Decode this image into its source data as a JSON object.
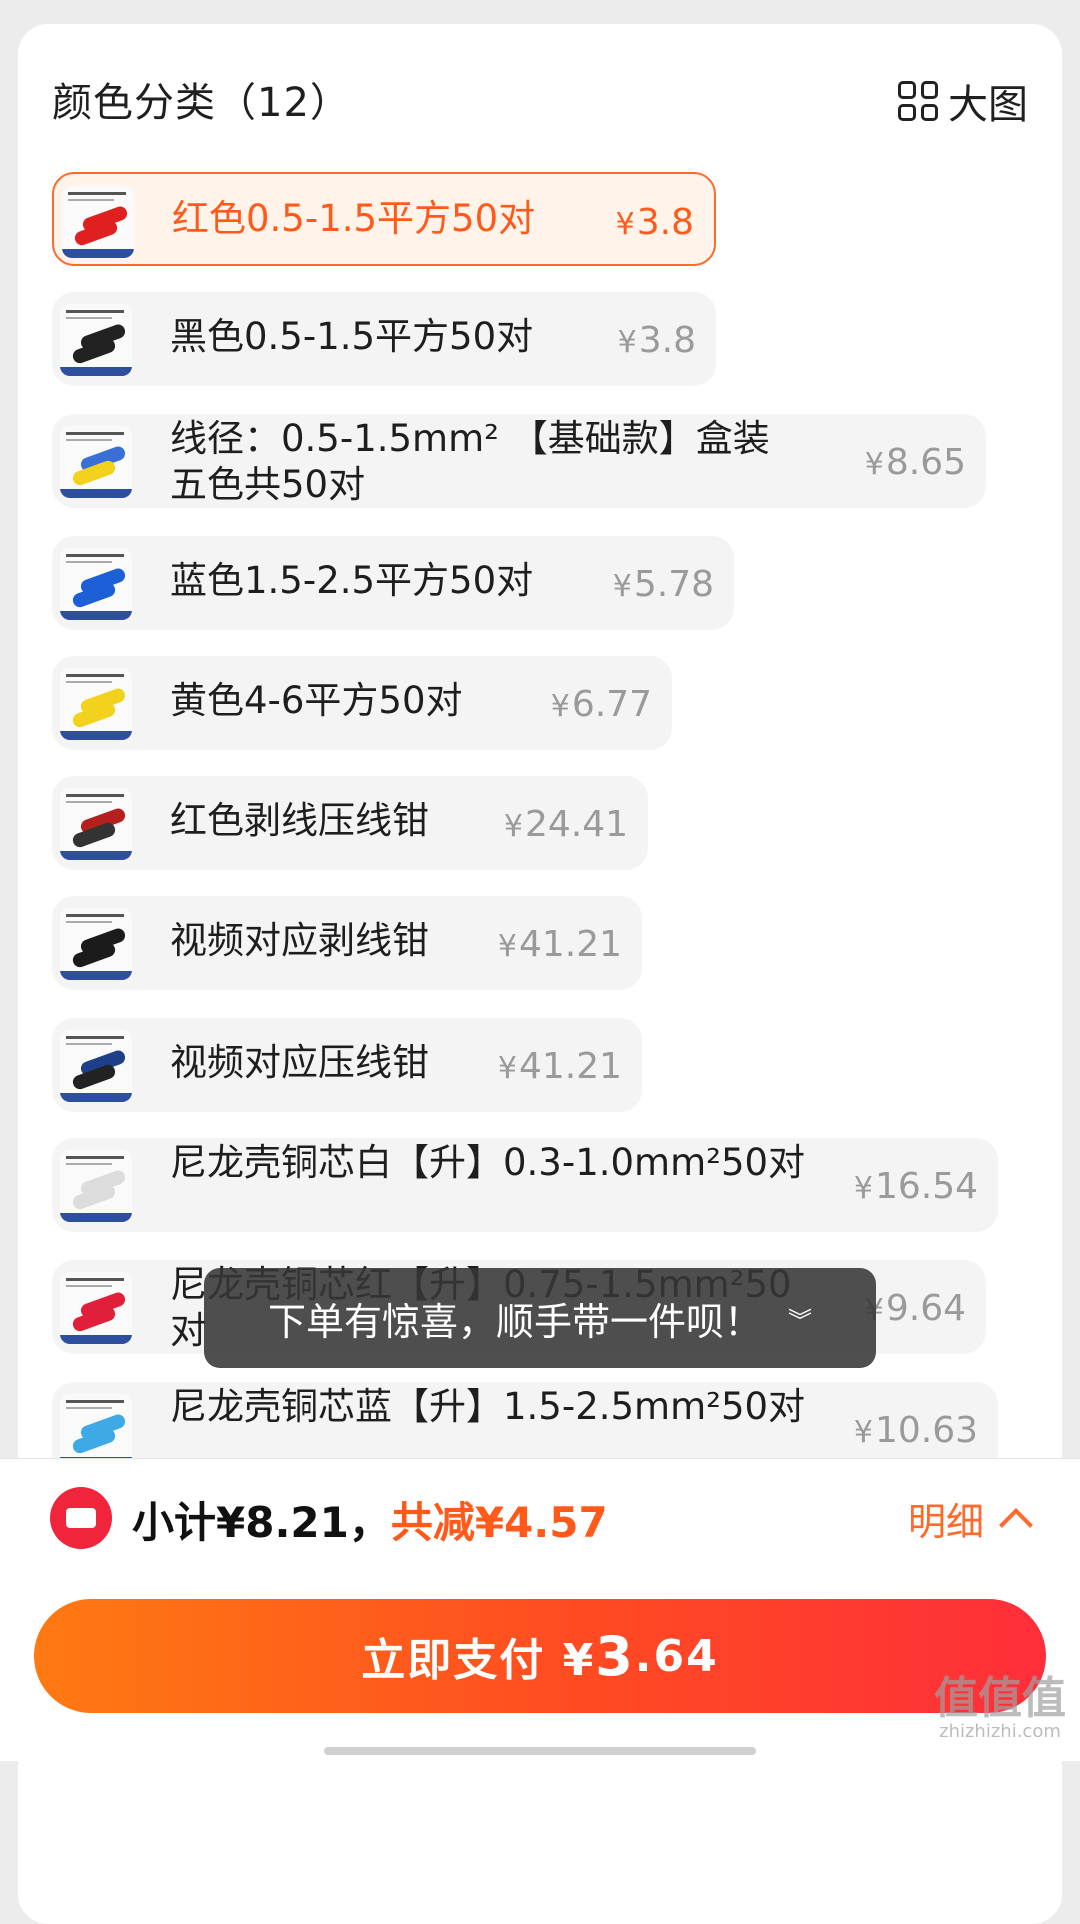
{
  "header": {
    "title": "颜色分类（12）",
    "view_large_label": "大图"
  },
  "colors": {
    "accent": "#ff5a1a",
    "selected_bg": "#fff3ea",
    "option_bg": "#f4f4f4",
    "pay_gradient_start": "#ff7a12",
    "pay_gradient_end": "#ff2e3a"
  },
  "options": [
    {
      "label": "红色0.5-1.5平方50对",
      "currency": "¥",
      "price": "3.8",
      "selected": true,
      "thumb_color": "#e02020"
    },
    {
      "label": "黑色0.5-1.5平方50对",
      "currency": "¥",
      "price": "3.8",
      "selected": false,
      "thumb_color": "#222222"
    },
    {
      "label": "线径：0.5-1.5mm² 【基础款】盒装五色共50对",
      "currency": "¥",
      "price": "8.65",
      "selected": false,
      "thumb_color": "#3b6fd8"
    },
    {
      "label": "蓝色1.5-2.5平方50对",
      "currency": "¥",
      "price": "5.78",
      "selected": false,
      "thumb_color": "#1c5fd6"
    },
    {
      "label": "黄色4-6平方50对",
      "currency": "¥",
      "price": "6.77",
      "selected": false,
      "thumb_color": "#f2d21c"
    },
    {
      "label": "红色剥线压线钳",
      "currency": "¥",
      "price": "24.41",
      "selected": false,
      "thumb_color": "#b3201e"
    },
    {
      "label": "视频对应剥线钳",
      "currency": "¥",
      "price": "41.21",
      "selected": false,
      "thumb_color": "#1b1b1b"
    },
    {
      "label": "视频对应压线钳",
      "currency": "¥",
      "price": "41.21",
      "selected": false,
      "thumb_color": "#1d3f8a"
    },
    {
      "label": "尼龙壳铜芯白【升】0.3-1.0mm²50对",
      "currency": "¥",
      "price": "16.54",
      "selected": false,
      "thumb_color": "#dcdcdc"
    },
    {
      "label": "尼龙壳铜芯红【升】0.75-1.5mm²50对",
      "currency": "¥",
      "price": "9.64",
      "selected": false,
      "thumb_color": "#e0203a"
    },
    {
      "label": "尼龙壳铜芯蓝【升】1.5-2.5mm²50对",
      "currency": "¥",
      "price": "10.63",
      "selected": false,
      "thumb_color": "#3fa9e6"
    }
  ],
  "toast": {
    "text": "下单有惊喜，顺手带一件呗！"
  },
  "footer": {
    "subtotal_label": "小计¥8.21，",
    "discount_label": "共减¥4.57",
    "details_label": "明细",
    "pay_label": "立即支付 ¥",
    "pay_amount_int": "3",
    "pay_amount_dec": ".64"
  },
  "watermark": {
    "main": "值值值",
    "sub": "zhizhizhi.com"
  }
}
